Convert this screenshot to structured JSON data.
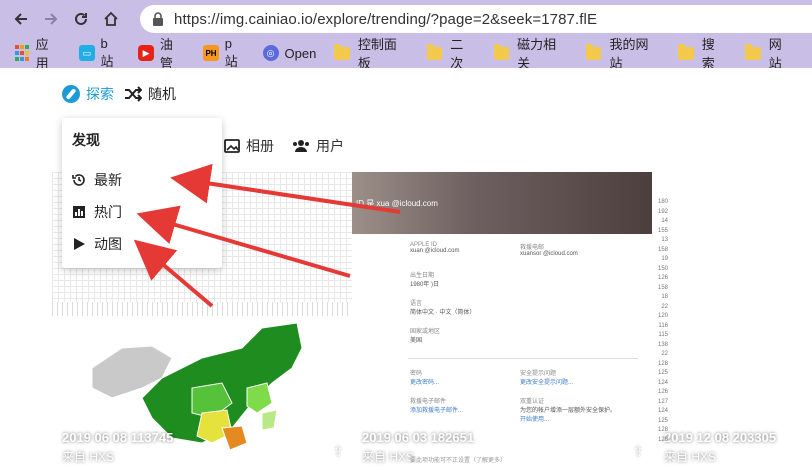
{
  "browser": {
    "url": "https://img.cainiao.io/explore/trending/?page=2&seek=1787.flE",
    "bookmarks": [
      {
        "label": "应用",
        "icon": "apps-grid-icon"
      },
      {
        "label": "b站",
        "icon": "bilibili-icon"
      },
      {
        "label": "油管",
        "icon": "youtube-icon"
      },
      {
        "label": "p站",
        "icon": "ph-icon"
      },
      {
        "label": "Open",
        "icon": "openai-icon"
      },
      {
        "label": "控制面板",
        "icon": "folder-icon"
      },
      {
        "label": "二次",
        "icon": "folder-icon"
      },
      {
        "label": "磁力相关",
        "icon": "folder-icon"
      },
      {
        "label": "我的网站",
        "icon": "folder-icon"
      },
      {
        "label": "搜索",
        "icon": "folder-icon"
      },
      {
        "label": "网站",
        "icon": "folder-icon"
      }
    ],
    "ph_badge": "PH"
  },
  "nav": {
    "explore": "探索",
    "random": "随机"
  },
  "subtabs": {
    "album": "相册",
    "users": "用户"
  },
  "dropdown": {
    "header": "发现",
    "items": [
      {
        "label": "最新",
        "icon": "history-icon"
      },
      {
        "label": "热门",
        "icon": "bar-chart-icon"
      },
      {
        "label": "动图",
        "icon": "play-icon"
      }
    ]
  },
  "cards": [
    {
      "timestamp": "2019 06 08 113745",
      "source": "来自 HXS"
    },
    {
      "timestamp": "2019 06 03 182651",
      "source": "来自 HXS"
    },
    {
      "timestamp": "2019 12 08 203305",
      "source": "来自 HXS"
    }
  ],
  "appleid": {
    "banner": "ID 是 xua          @icloud.com",
    "fields": [
      {
        "label": "APPLE ID",
        "value": "xuan        @icloud.com"
      },
      {
        "label": "救援电邮",
        "value": "xuansor       @icloud.com"
      },
      {
        "label": "出生日期",
        "value": "1980年      )日"
      },
      {
        "label": "语言",
        "value": "简体中文 · 中文（简体）"
      },
      {
        "label": "国家或地区",
        "value": "美国"
      },
      {
        "label": "密码",
        "value": "更改密码..."
      },
      {
        "label": "安全提示问题",
        "value": "更改安全提示问题..."
      },
      {
        "label": "救援电子邮件",
        "value": "添加救援电子邮件..."
      },
      {
        "label": "双重认证",
        "value": "为您的帐户增添一层额外安全保护。"
      },
      {
        "label": "",
        "value": "开始使用..."
      }
    ],
    "footer": "要此项功能可不正设置（了解更多）"
  }
}
